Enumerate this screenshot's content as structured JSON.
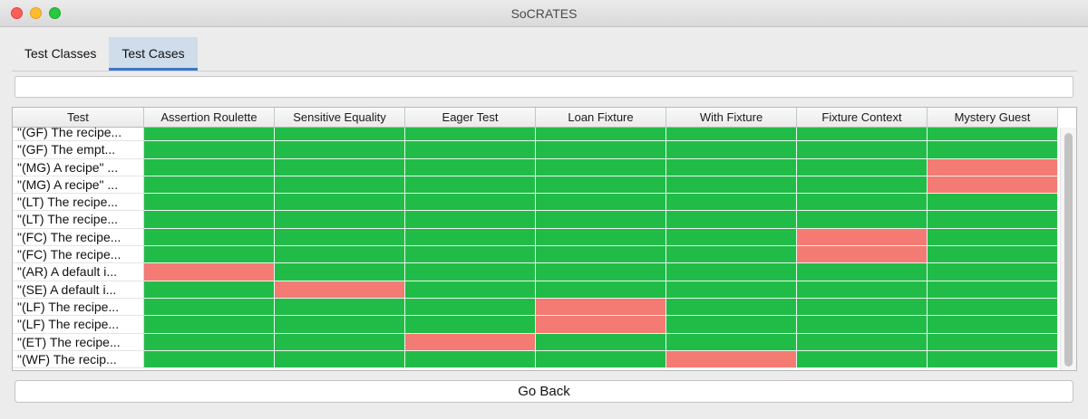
{
  "window": {
    "title": "SoCRATES"
  },
  "tabs": [
    {
      "label": "Test Classes",
      "active": false
    },
    {
      "label": "Test Cases",
      "active": true
    }
  ],
  "search": {
    "value": ""
  },
  "table": {
    "columns": [
      "Test",
      "Assertion Roulette",
      "Sensitive Equality",
      "Eager Test",
      "Loan Fixture",
      "With Fixture",
      "Fixture Context",
      "Mystery Guest"
    ],
    "rows": [
      {
        "test": "\"(GF) The recipe...",
        "smells": [
          0,
          0,
          0,
          0,
          0,
          0,
          0
        ]
      },
      {
        "test": "\"(GF) The empt...",
        "smells": [
          0,
          0,
          0,
          0,
          0,
          0,
          0
        ]
      },
      {
        "test": "\"(MG) A recipe\" ...",
        "smells": [
          0,
          0,
          0,
          0,
          0,
          0,
          1
        ]
      },
      {
        "test": "\"(MG) A recipe\" ...",
        "smells": [
          0,
          0,
          0,
          0,
          0,
          0,
          1
        ]
      },
      {
        "test": "\"(LT) The recipe...",
        "smells": [
          0,
          0,
          0,
          0,
          0,
          0,
          0
        ]
      },
      {
        "test": "\"(LT) The recipe...",
        "smells": [
          0,
          0,
          0,
          0,
          0,
          0,
          0
        ]
      },
      {
        "test": "\"(FC) The recipe...",
        "smells": [
          0,
          0,
          0,
          0,
          0,
          1,
          0
        ]
      },
      {
        "test": "\"(FC) The recipe...",
        "smells": [
          0,
          0,
          0,
          0,
          0,
          1,
          0
        ]
      },
      {
        "test": "\"(AR) A default i...",
        "smells": [
          1,
          0,
          0,
          0,
          0,
          0,
          0
        ]
      },
      {
        "test": "\"(SE) A default i...",
        "smells": [
          0,
          1,
          0,
          0,
          0,
          0,
          0
        ]
      },
      {
        "test": "\"(LF) The recipe...",
        "smells": [
          0,
          0,
          0,
          1,
          0,
          0,
          0
        ]
      },
      {
        "test": "\"(LF) The recipe...",
        "smells": [
          0,
          0,
          0,
          1,
          0,
          0,
          0
        ]
      },
      {
        "test": "\"(ET) The recipe...",
        "smells": [
          0,
          0,
          1,
          0,
          0,
          0,
          0
        ]
      },
      {
        "test": "\"(WF) The recip...",
        "smells": [
          0,
          0,
          0,
          0,
          1,
          0,
          0
        ]
      }
    ]
  },
  "colors": {
    "clean": "#21bc48",
    "smell": "#f47a74"
  },
  "buttons": {
    "go_back": "Go Back"
  }
}
